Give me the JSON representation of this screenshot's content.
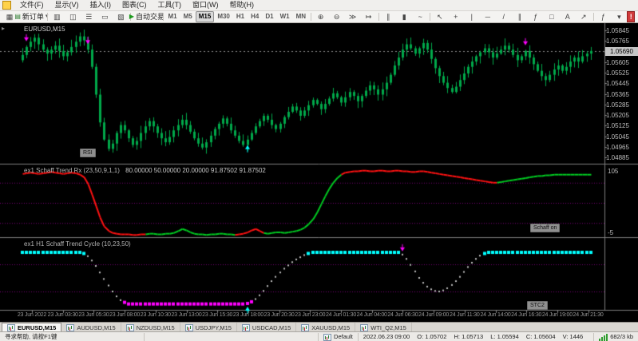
{
  "menu": {
    "items": [
      "文件(F)",
      "显示(V)",
      "插入(I)",
      "图表(C)",
      "工具(T)",
      "窗口(W)",
      "帮助(H)"
    ]
  },
  "toolbar": {
    "new_order": "新订单",
    "auto_trading": "自动交易",
    "timeframes": {
      "items": [
        "M1",
        "M5",
        "M15",
        "M30",
        "H1",
        "H4",
        "D1",
        "W1",
        "MN"
      ],
      "active": "M15"
    },
    "layout": [
      {
        "t": "icon",
        "name": "new-chart-icon",
        "g": "▦"
      },
      {
        "t": "btn",
        "name": "new-order-button",
        "icon_name": "order-icon",
        "icon_g": "▤",
        "icon_c": "#2e7d32",
        "label_key": "new_order",
        "caret": true
      },
      {
        "t": "sep"
      },
      {
        "t": "icon",
        "name": "market-watch-icon",
        "g": "▥"
      },
      {
        "t": "icon",
        "name": "data-window-icon",
        "g": "◫"
      },
      {
        "t": "icon",
        "name": "navigator-icon",
        "g": "☰"
      },
      {
        "t": "icon",
        "name": "terminal-icon",
        "g": "▭"
      },
      {
        "t": "icon",
        "name": "strategy-tester-icon",
        "g": "▧"
      },
      {
        "t": "sep"
      },
      {
        "t": "btn",
        "name": "auto-trading-button",
        "icon_name": "play-icon",
        "icon_g": "▶",
        "icon_c": "#1d9a1d",
        "label_key": "auto_trading",
        "caret": false
      },
      {
        "t": "sep"
      },
      {
        "t": "tfs"
      },
      {
        "t": "sep"
      },
      {
        "t": "icon",
        "name": "zoom-in-icon",
        "g": "⊕"
      },
      {
        "t": "icon",
        "name": "zoom-out-icon",
        "g": "⊖"
      },
      {
        "t": "icon",
        "name": "auto-scroll-icon",
        "g": "≫"
      },
      {
        "t": "icon",
        "name": "chart-shift-icon",
        "g": "↦"
      },
      {
        "t": "sep"
      },
      {
        "t": "icon",
        "name": "bar-chart-icon",
        "g": "∥"
      },
      {
        "t": "icon",
        "name": "candlestick-chart-icon",
        "g": "▮"
      },
      {
        "t": "icon",
        "name": "line-chart-icon",
        "g": "~"
      },
      {
        "t": "sep"
      },
      {
        "t": "icon",
        "name": "cursor-icon",
        "g": "↖"
      },
      {
        "t": "icon",
        "name": "crosshair-icon",
        "g": "+"
      },
      {
        "t": "icon",
        "name": "vertical-line-icon",
        "g": "|"
      },
      {
        "t": "icon",
        "name": "horizontal-line-icon",
        "g": "─"
      },
      {
        "t": "icon",
        "name": "trendline-icon",
        "g": "/"
      },
      {
        "t": "icon",
        "name": "equidistant-channel-icon",
        "g": "∥"
      },
      {
        "t": "icon",
        "name": "fibonacci-icon",
        "g": "ƒ"
      },
      {
        "t": "icon",
        "name": "shapes-icon",
        "g": "□"
      },
      {
        "t": "icon",
        "name": "text-label-icon",
        "g": "A"
      },
      {
        "t": "icon",
        "name": "arrow-tool-icon",
        "g": "↗"
      },
      {
        "t": "sep"
      },
      {
        "t": "icon",
        "name": "indicators-list-icon",
        "g": "ƒ"
      },
      {
        "t": "icon",
        "name": "period-dropdown-icon",
        "g": "▾"
      }
    ],
    "red_icon_glyph": "!"
  },
  "chart": {
    "symbol_label": "EURUSD,M15",
    "one_click_toggle": "▸",
    "bid": "1.05690",
    "buttons": {
      "rsi": "RSI",
      "schaff": "Schaff on",
      "stc": "STC2"
    }
  },
  "indicator1": {
    "title": "ex1 Schaff Trend Rx (23,50,9,1,1)",
    "values": "80.00000 50.00000 20.00000 91.87502 91.87502",
    "axis_top": "105",
    "axis_bottom": "-5"
  },
  "indicator2": {
    "title": "ex1 H1 Schaff Trend Cycle (10,23,50)"
  },
  "tabs": [
    "EURUSD,M15",
    "AUDUSD,M15",
    "NZDUSD,M15",
    "USDJPY,M15",
    "USDCAD,M15",
    "XAUUSD,M15",
    "WTI_Q2,M15"
  ],
  "status_bar": {
    "help": "寻求帮助, 请按F1键",
    "profile": "Default",
    "quote": {
      "time": "2022.06.23 09:00",
      "open": "O: 1.05702",
      "high": "H: 1.05713",
      "low": "L: 1.05594",
      "close": "C: 1.05604",
      "volume": "V: 1446"
    },
    "traffic": "682/3 kb"
  },
  "chart_data": {
    "type": "candlestick",
    "symbol": "EURUSD",
    "timeframe": "M15",
    "price_range": [
      1.0485,
      1.059
    ],
    "bid": 1.0569,
    "price_axis_labels": [
      "1.05845",
      "1.05765",
      "1.05685",
      "1.05605",
      "1.05525",
      "1.05445",
      "1.05365",
      "1.05285",
      "1.05205",
      "1.05125",
      "1.05045",
      "1.04965",
      "1.04885"
    ],
    "x_labels": [
      "23 Jun 2022",
      "23 Jun 03:30",
      "23 Jun 05:30",
      "23 Jun 08:00",
      "23 Jun 10:30",
      "23 Jun 13:00",
      "23 Jun 15:30",
      "23 Jun 18:00",
      "23 Jun 20:30",
      "23 Jun 23:00",
      "24 Jun 01:30",
      "24 Jun 04:00",
      "24 Jun 06:30",
      "24 Jun 09:00",
      "24 Jun 11:30",
      "24 Jun 14:00",
      "24 Jun 16:30",
      "24 Jun 19:00",
      "24 Jun 21:30"
    ],
    "closes": [
      1.0566,
      1.0572,
      1.0576,
      1.0579,
      1.0574,
      1.057,
      1.0567,
      1.057,
      1.0573,
      1.0569,
      1.0565,
      1.0568,
      1.0572,
      1.0576,
      1.058,
      1.0577,
      1.057,
      1.0557,
      1.0536,
      1.0515,
      1.0502,
      1.0495,
      1.0499,
      1.0507,
      1.0513,
      1.0509,
      1.0503,
      1.0498,
      1.0501,
      1.0507,
      1.0512,
      1.0516,
      1.0512,
      1.0507,
      1.0503,
      1.05,
      1.0504,
      1.0509,
      1.0513,
      1.0517,
      1.0513,
      1.0508,
      1.0503,
      1.0499,
      1.0496,
      1.05,
      1.0505,
      1.051,
      1.0514,
      1.0518,
      1.0514,
      1.0509,
      1.0505,
      1.0501,
      1.0498,
      1.0502,
      1.0507,
      1.0512,
      1.0516,
      1.052,
      1.0517,
      1.0513,
      1.051,
      1.0514,
      1.0519,
      1.0523,
      1.0527,
      1.0524,
      1.052,
      1.0524,
      1.0528,
      1.0532,
      1.0529,
      1.0525,
      1.0529,
      1.0533,
      1.0537,
      1.0534,
      1.053,
      1.0534,
      1.0538,
      1.0535,
      1.0531,
      1.0535,
      1.0539,
      1.0543,
      1.054,
      1.0536,
      1.054,
      1.0545,
      1.0551,
      1.0558,
      1.0564,
      1.057,
      1.0574,
      1.0571,
      1.0567,
      1.0571,
      1.0575,
      1.057,
      1.0563,
      1.0556,
      1.055,
      1.0545,
      1.0541,
      1.0538,
      1.0542,
      1.0547,
      1.0552,
      1.0557,
      1.0561,
      1.0565,
      1.0568,
      1.0571,
      1.0568,
      1.0564,
      1.0567,
      1.057,
      1.0573,
      1.057,
      1.0566,
      1.0562,
      1.0565,
      1.0569,
      1.0564,
      1.0559,
      1.0554,
      1.055,
      1.0547,
      1.0551,
      1.0555,
      1.0558,
      1.0554,
      1.0557,
      1.0561,
      1.0564,
      1.0561,
      1.0565,
      1.0567,
      1.0569
    ],
    "arrows": [
      {
        "i": 1,
        "dir": "down"
      },
      {
        "i": 16,
        "dir": "down"
      },
      {
        "i": 55,
        "dir": "up"
      },
      {
        "i": 123,
        "dir": "down"
      }
    ],
    "indicators": [
      {
        "name": "Schaff Trend Rx",
        "params": "(23,50,9,1,1)",
        "range": [
          -5,
          105
        ],
        "levels": [
          80,
          50,
          20
        ],
        "red_segments": [
          [
            0,
            30
          ],
          [
            53,
            59
          ],
          [
            79,
            116
          ]
        ],
        "colors": {
          "up": "#00CC22",
          "down": "#FF1212"
        },
        "values": [
          93,
          94,
          95,
          94,
          93,
          94,
          95,
          96,
          95,
          94,
          93,
          94,
          95,
          94,
          92,
          88,
          78,
          62,
          45,
          28,
          15,
          8,
          5,
          4,
          3,
          3,
          3,
          2,
          2,
          3,
          3,
          4,
          4,
          3,
          3,
          4,
          4,
          5,
          8,
          11,
          9,
          6,
          4,
          3,
          3,
          2,
          3,
          3,
          4,
          4,
          3,
          3,
          2,
          3,
          4,
          6,
          9,
          11,
          8,
          5,
          4,
          5,
          6,
          6,
          5,
          6,
          7,
          8,
          10,
          13,
          18,
          26,
          36,
          48,
          60,
          71,
          80,
          87,
          92,
          95,
          96,
          97,
          97,
          98,
          98,
          97,
          97,
          98,
          98,
          97,
          97,
          98,
          98,
          97,
          97,
          96,
          96,
          97,
          97,
          96,
          95,
          94,
          93,
          92,
          91,
          90,
          89,
          88,
          87,
          86,
          85,
          84,
          83,
          82,
          81,
          80,
          80,
          81,
          82,
          83,
          84,
          85,
          86,
          87,
          88,
          89,
          90,
          90,
          91,
          91,
          92,
          92,
          92,
          92,
          92,
          92,
          92,
          92,
          92,
          91.9
        ]
      },
      {
        "name": "Schaff Trend Cycle",
        "params": "(10,23,50)",
        "range": [
          0,
          100
        ],
        "levels": [
          75,
          25
        ],
        "colors": {
          "high": "#00FFFF",
          "low": "#FF00FF",
          "mid": "#C0C0C0"
        },
        "arrows": [
          {
            "i": 55,
            "dir": "up"
          },
          {
            "i": 93,
            "dir": "down"
          }
        ],
        "values": [
          97,
          97,
          97,
          97,
          97,
          97,
          97,
          97,
          97,
          97,
          97,
          97,
          97,
          97,
          97,
          95,
          90,
          82,
          72,
          60,
          48,
          36,
          25,
          16,
          9,
          5,
          2,
          2,
          2,
          2,
          2,
          2,
          2,
          2,
          2,
          2,
          2,
          2,
          2,
          2,
          2,
          2,
          2,
          2,
          2,
          2,
          2,
          2,
          2,
          2,
          2,
          2,
          2,
          2,
          2,
          3,
          6,
          11,
          18,
          26,
          35,
          44,
          52,
          60,
          67,
          73,
          79,
          84,
          88,
          92,
          95,
          97,
          97,
          97,
          97,
          97,
          97,
          97,
          97,
          97,
          97,
          97,
          97,
          97,
          97,
          97,
          97,
          97,
          97,
          97,
          97,
          97,
          97,
          93,
          85,
          74,
          62,
          50,
          41,
          34,
          29,
          26,
          25,
          27,
          31,
          37,
          44,
          52,
          61,
          70,
          78,
          85,
          91,
          95,
          97,
          97,
          97,
          97,
          97,
          97,
          97,
          97,
          97,
          97,
          97,
          97,
          97,
          97,
          97,
          97,
          97,
          97,
          97,
          97,
          97,
          97,
          97,
          97,
          97,
          97
        ]
      }
    ],
    "colors": {
      "background": "#000000",
      "candle": "#00A84A",
      "arrow_down": "#FF00FF",
      "arrow_up": "#00FFFF",
      "level_line": "#7A007A",
      "bid_line": "#8A8A8A",
      "axis_text": "#BDBDBD"
    }
  }
}
